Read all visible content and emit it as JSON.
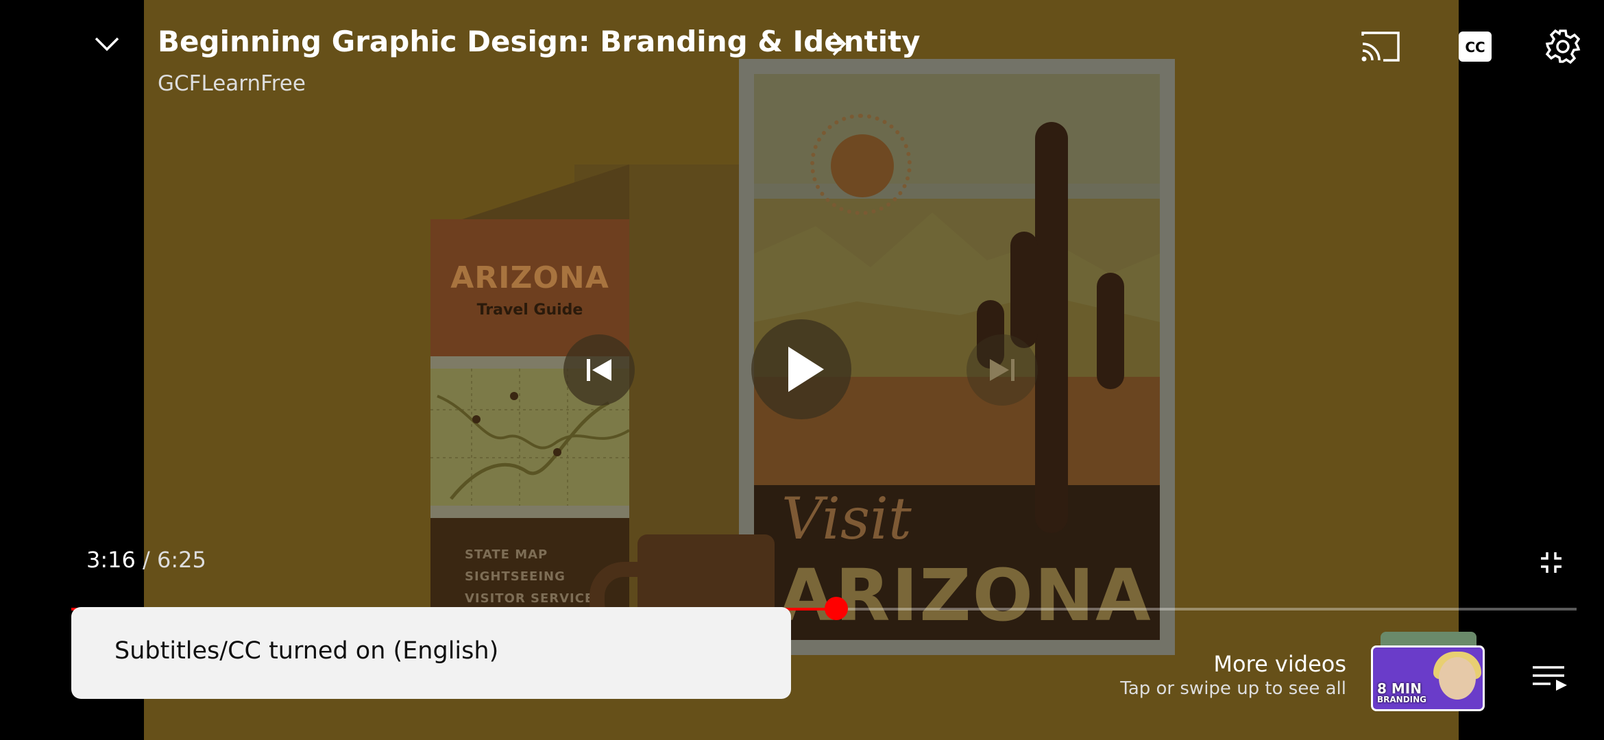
{
  "video": {
    "title": "Beginning Graphic Design: Branding & Identity",
    "channel": "GCFLearnFree",
    "artwork": {
      "brochure_title": "ARIZONA",
      "brochure_subtitle": "Travel Guide",
      "brochure_items": [
        "STATE MAP",
        "SIGHTSEEING",
        "VISITOR SERVICES"
      ],
      "poster_script": "Visit",
      "poster_title": "ARIZONA"
    }
  },
  "playback": {
    "current_time": "3:16",
    "separator": " / ",
    "duration": "6:25",
    "progress_fraction": 0.508
  },
  "toast": {
    "message": "Subtitles/CC turned on (English)"
  },
  "more_videos": {
    "title": "More videos",
    "subtitle": "Tap or swipe up to see all",
    "thumbnail_badge_big": "8 MIN",
    "thumbnail_badge_small": "BRANDING"
  },
  "icons": {
    "collapse": "chevron-down-icon",
    "title_more": "chevron-right-icon",
    "cast": "cast-icon",
    "captions": "cc-icon",
    "settings": "gear-icon",
    "previous": "skip-previous-icon",
    "play": "play-icon",
    "next": "skip-next-icon",
    "fullscreen_exit": "fullscreen-exit-icon",
    "playlist": "playlist-icon"
  },
  "colors": {
    "progress": "#ff0000",
    "toast_bg": "#f2f2f2"
  }
}
